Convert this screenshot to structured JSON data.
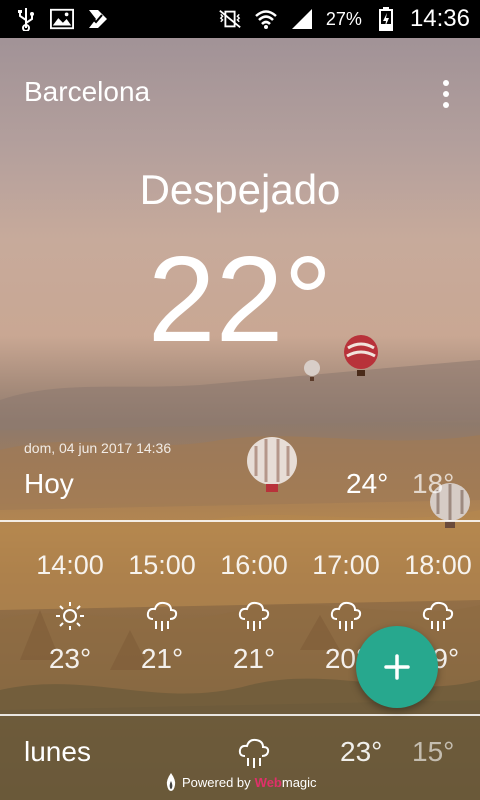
{
  "status_bar": {
    "icons_left": [
      "usb-icon",
      "image-icon",
      "app-notification-icon"
    ],
    "icons_right": [
      "vibrate-mute-icon",
      "wifi-icon",
      "signal-icon"
    ],
    "battery_percent": "27%",
    "battery_level": 0.27,
    "time": "14:36"
  },
  "header": {
    "city": "Barcelona"
  },
  "current": {
    "condition": "Despejado",
    "temperature": "22°"
  },
  "today": {
    "timestamp": "dom, 04 jun 2017 14:36",
    "label": "Hoy",
    "high": "24°",
    "low": "18°"
  },
  "hourly": [
    {
      "time": "14:00",
      "icon": "sun-icon",
      "temp": "23°"
    },
    {
      "time": "15:00",
      "icon": "rain-cloud-icon",
      "temp": "21°"
    },
    {
      "time": "16:00",
      "icon": "rain-cloud-icon",
      "temp": "21°"
    },
    {
      "time": "17:00",
      "icon": "rain-cloud-icon",
      "temp": "20°"
    },
    {
      "time": "18:00",
      "icon": "rain-cloud-icon",
      "temp": "19°"
    }
  ],
  "next_day": {
    "label": "lunes",
    "icon": "rain-cloud-icon",
    "high": "23°",
    "low": "15°"
  },
  "footer": {
    "powered_prefix": "Powered by",
    "brand_part1": "Web",
    "brand_part2": "magic"
  },
  "colors": {
    "fab": "#27a88e",
    "status_bar": "#000000",
    "brand_accent": "#e0306a"
  }
}
